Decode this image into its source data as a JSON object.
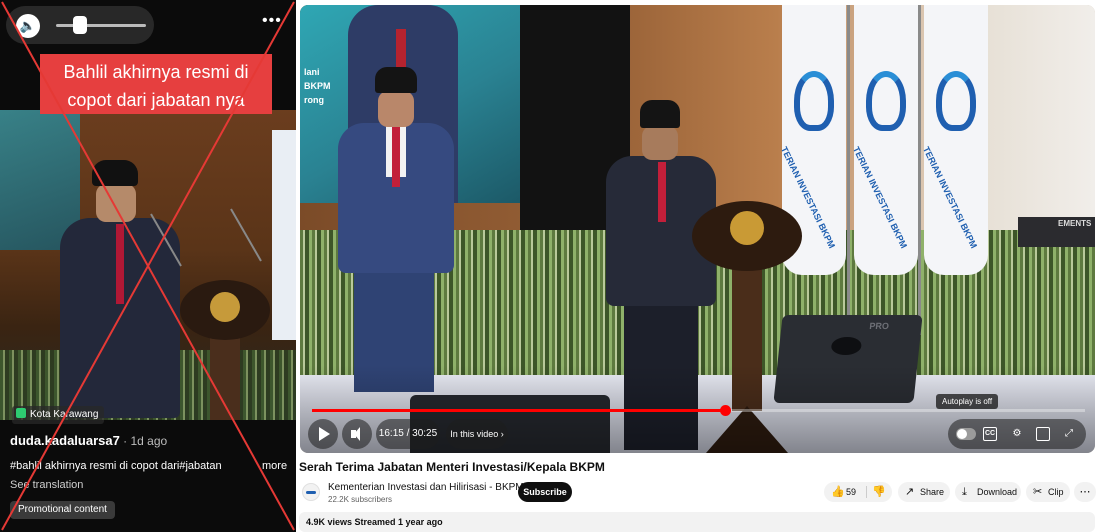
{
  "left_panel": {
    "volume_icon": "speaker-icon",
    "more_icon": "ellipsis-icon",
    "more_symbol": "•••",
    "caption": "Bahlil akhirnya resmi di copot dari jabatan nya",
    "location": "Kota Karawang",
    "username": "duda.kadaluarsa7",
    "age": " · 1d ago",
    "description": "#bahlil akhirnya resmi di copot dari#jabatan",
    "more_label": "more",
    "see_translation": "See translation",
    "promo_label": "Promotional content",
    "overlay_color": "#e53935"
  },
  "player": {
    "time": "16:15 / 30:25",
    "chapter": "In this video ›",
    "autoplay_tooltip": "Autoplay is off",
    "cc_label": "CC",
    "progress_fraction": 0.5342,
    "progress_color": "#ff0000",
    "scene": {
      "screen_label_1": "lani",
      "screen_label_2": "BKPM",
      "screen_label_3": "rong",
      "flag_text": "TERIAN INVESTASI BKPM",
      "speaker_brand": "PRO",
      "keyboard_text": "EMENTS"
    }
  },
  "video": {
    "title": "Serah Terima Jabatan Menteri Investasi/Kepala BKPM",
    "channel": "Kementerian Investasi dan Hilirisasi - BKPM",
    "subscribers": "22.2K subscribers",
    "subscribe_label": "Subscribe",
    "likes": "59",
    "share_label": "Share",
    "download_label": "Download",
    "clip_label": "Clip",
    "views_meta": "4.9K views  Streamed 1 year ago"
  }
}
